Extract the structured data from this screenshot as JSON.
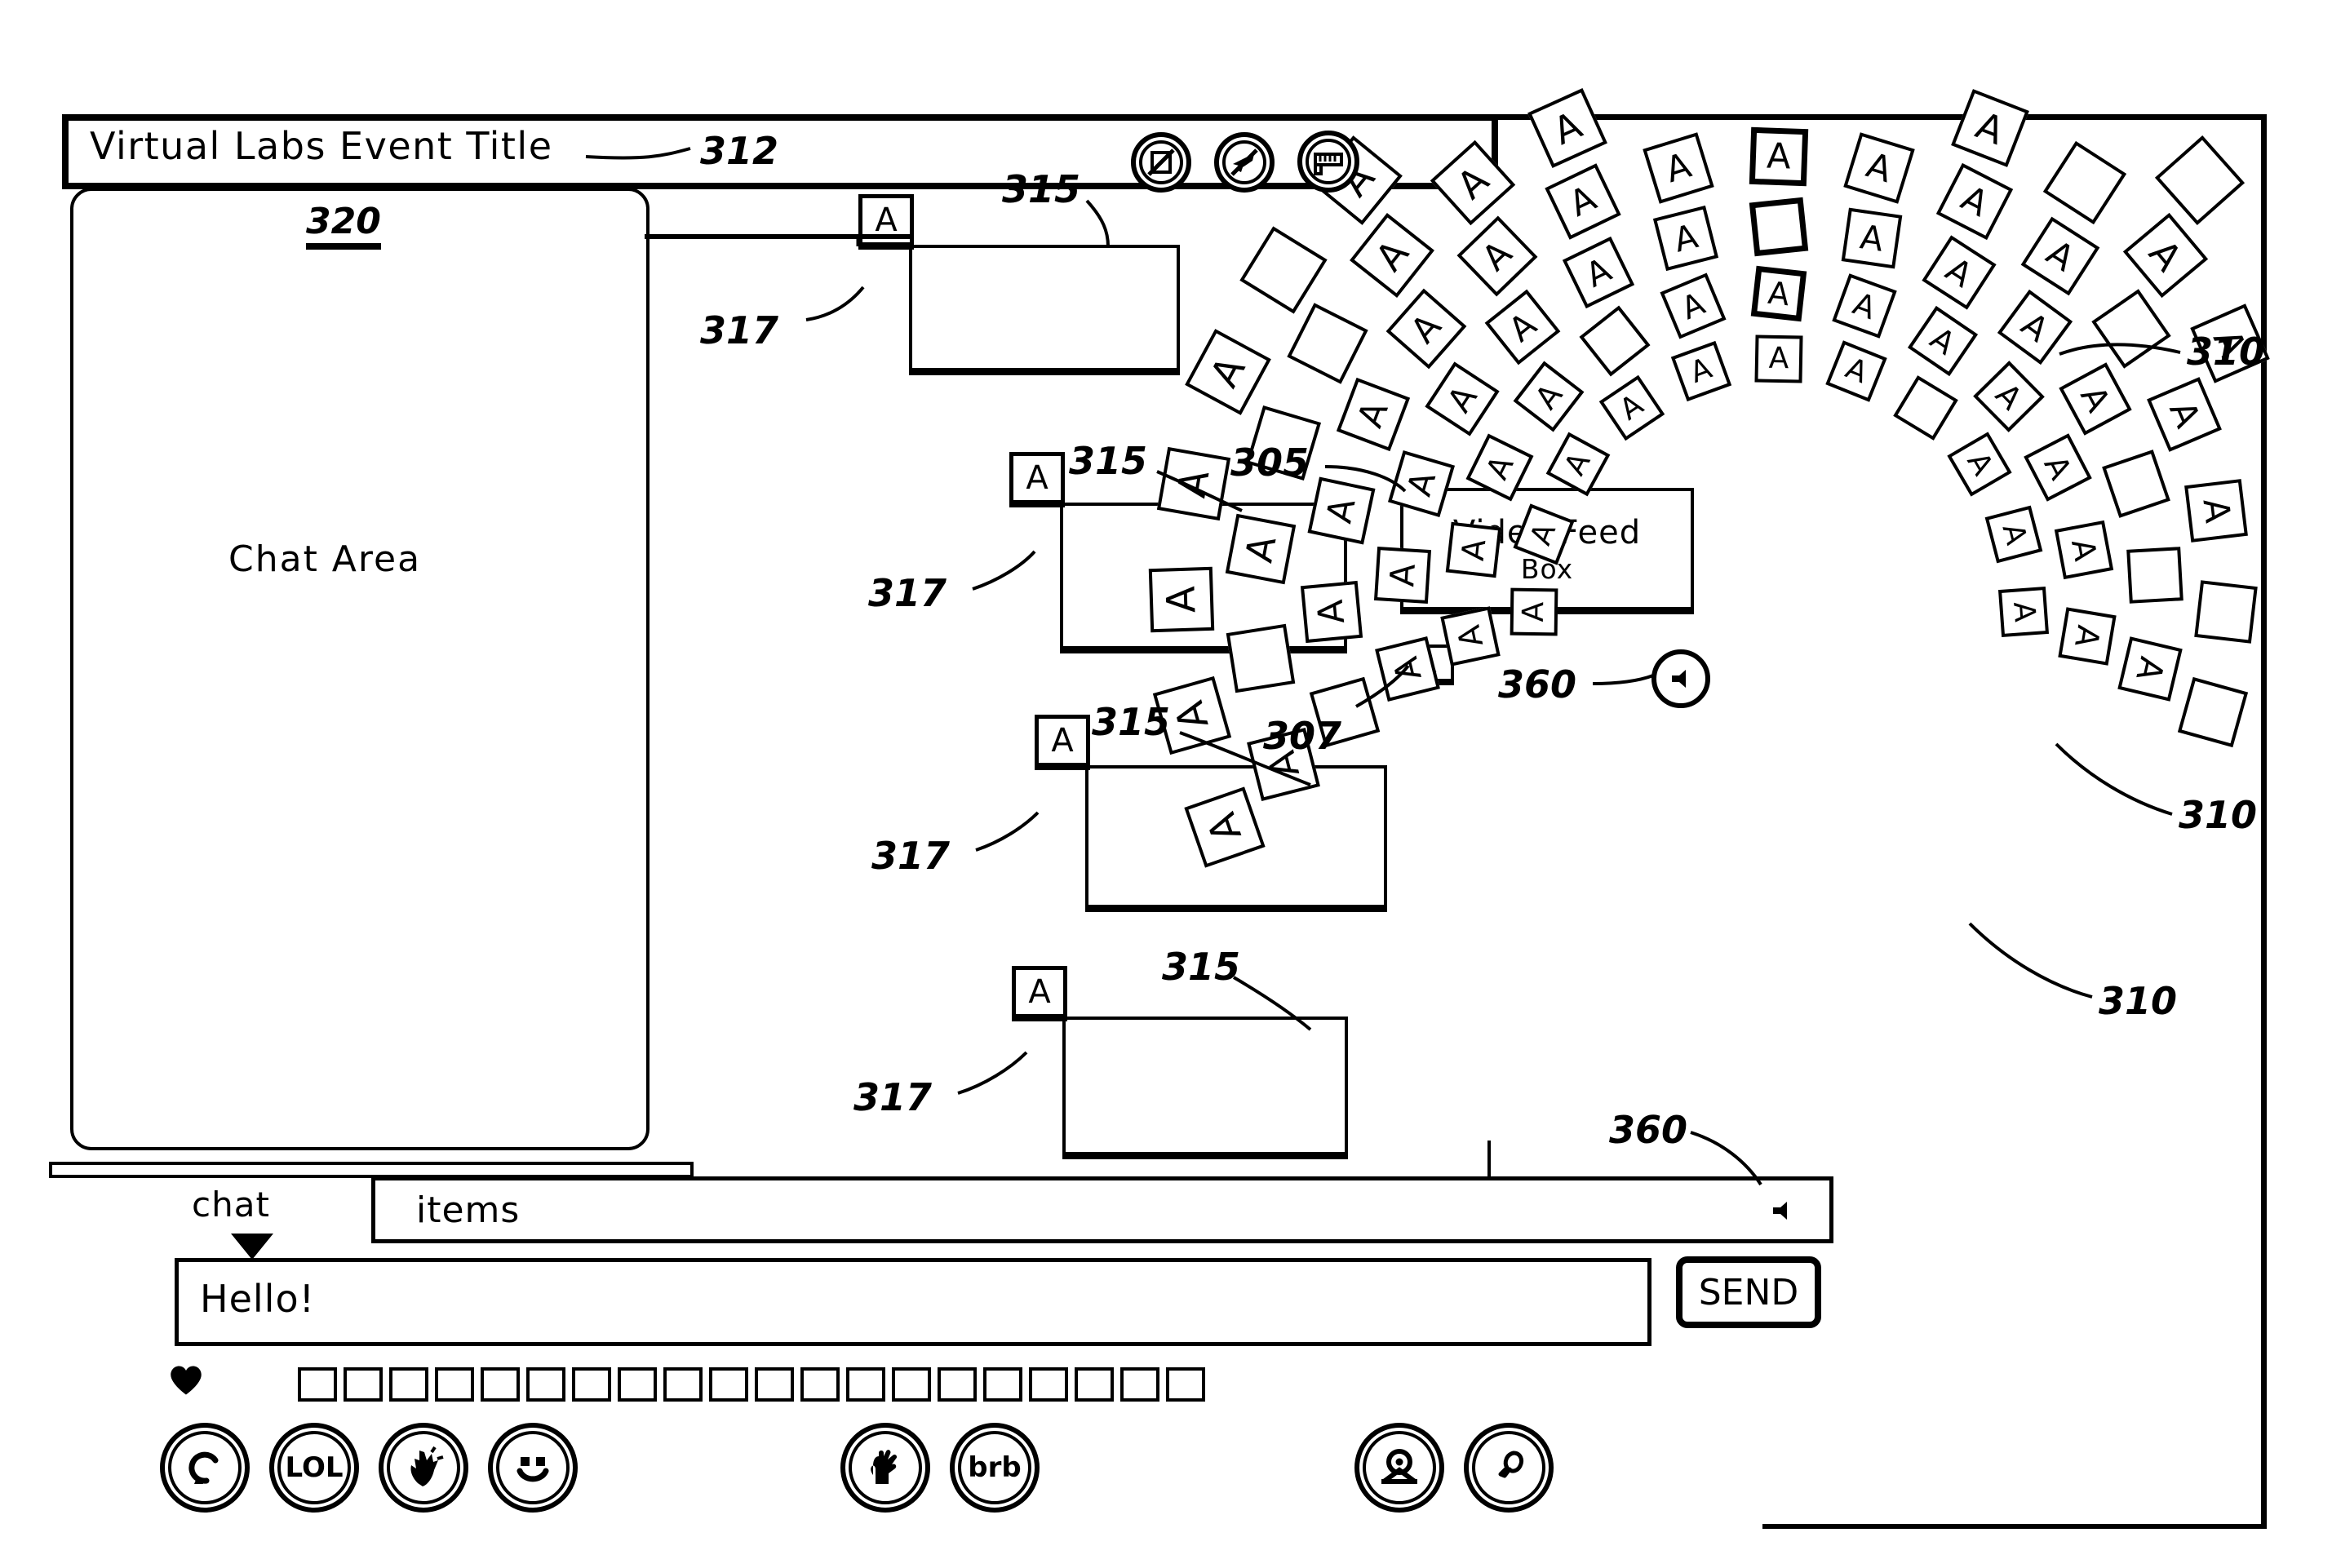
{
  "figure": {
    "type": "patent-diagram",
    "subject": "Virtual event / virtual labs user interface layout"
  },
  "header": {
    "title": "Virtual Labs Event Title",
    "title_ref": "312"
  },
  "chat_panel": {
    "ref": "320",
    "label": "Chat Area",
    "scrollbar_name": "chat-scrollbar"
  },
  "video_feed": {
    "line1": "Video Feed",
    "line2": "Box",
    "ref": "305",
    "badge_letter": "A",
    "badge_ref": "307"
  },
  "feed_boxes": [
    {
      "badge_letter": "A",
      "box_ref": "315",
      "badge_ref": "317"
    },
    {
      "badge_letter": "A",
      "box_ref": "315",
      "badge_ref": "317"
    },
    {
      "badge_letter": "A",
      "box_ref": "315",
      "badge_ref": "317"
    },
    {
      "badge_letter": "A",
      "box_ref": "315",
      "badge_ref": "317"
    }
  ],
  "seating_refs": [
    "310",
    "310",
    "310"
  ],
  "speaker_refs": [
    "360",
    "360"
  ],
  "top_icons": [
    {
      "name": "no-recording-icon",
      "title": "no recording"
    },
    {
      "name": "no-airplane-icon",
      "title": "no airplane / offline"
    },
    {
      "name": "ruler-measure-icon",
      "title": "measure"
    }
  ],
  "toolbar": {
    "chat_dropdown_label": "chat",
    "items_label": "items",
    "message_value": "Hello!",
    "send_label": "SEND",
    "heart_icon": "heart-icon",
    "emoji_slot_count": 20,
    "speaker_icon": "speaker-icon"
  },
  "reaction_buttons": [
    {
      "name": "replay-button",
      "label": "",
      "icon": "circular-arrow-icon"
    },
    {
      "name": "lol-button",
      "label": "LOL",
      "icon": "text-icon"
    },
    {
      "name": "applause-button",
      "label": "",
      "icon": "clapping-hands-icon"
    },
    {
      "name": "smiley-button",
      "label": "",
      "icon": "smiley-face-icon"
    },
    {
      "name": "raise-hand-button",
      "label": "",
      "icon": "raised-hand-icon"
    },
    {
      "name": "brb-button",
      "label": "brb",
      "icon": "text-icon"
    },
    {
      "name": "webcam-button",
      "label": "",
      "icon": "webcam-icon"
    },
    {
      "name": "microphone-button",
      "label": "",
      "icon": "microphone-icon"
    }
  ],
  "seats": {
    "letter": "A",
    "description": "Avatar tiles arranged in concentric arcs around the video feed"
  },
  "colors": {
    "ink": "#000000",
    "paper": "#ffffff"
  }
}
